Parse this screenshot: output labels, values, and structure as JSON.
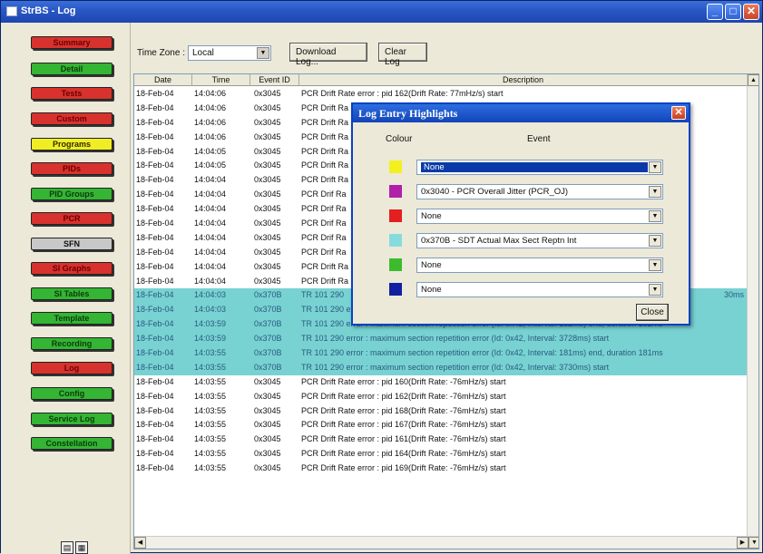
{
  "window": {
    "title": "StrBS - Log"
  },
  "sidebar": {
    "items": [
      {
        "label": "Summary",
        "color": "red"
      },
      {
        "label": "Detail",
        "color": "green"
      },
      {
        "label": "Tests",
        "color": "red"
      },
      {
        "label": "Custom",
        "color": "red"
      },
      {
        "label": "Programs",
        "color": "yellow"
      },
      {
        "label": "PIDs",
        "color": "red"
      },
      {
        "label": "PID Groups",
        "color": "green"
      },
      {
        "label": "PCR",
        "color": "red"
      },
      {
        "label": "SFN",
        "color": "gray"
      },
      {
        "label": "SI Graphs",
        "color": "red"
      },
      {
        "label": "SI Tables",
        "color": "green"
      },
      {
        "label": "Template",
        "color": "green"
      },
      {
        "label": "Recording",
        "color": "green"
      },
      {
        "label": "Log",
        "color": "red"
      },
      {
        "label": "Config",
        "color": "green"
      },
      {
        "label": "Service Log",
        "color": "green"
      },
      {
        "label": "Constellation",
        "color": "green"
      }
    ]
  },
  "toolbar": {
    "timezone_label": "Time Zone :",
    "timezone_value": "Local",
    "download_label": "Download Log...",
    "clear_label": "Clear Log"
  },
  "log": {
    "headers": [
      "Date",
      "Time",
      "Event ID",
      "Description"
    ],
    "rows": [
      {
        "date": "18-Feb-04",
        "time": "14:04:06",
        "id": "0x3045",
        "desc": "PCR Drift Rate error : pid 162(Drift Rate: 77mHz/s) start",
        "hl": false
      },
      {
        "date": "18-Feb-04",
        "time": "14:04:06",
        "id": "0x3045",
        "desc": "PCR Drift Ra",
        "hl": false
      },
      {
        "date": "18-Feb-04",
        "time": "14:04:06",
        "id": "0x3045",
        "desc": "PCR Drift Ra",
        "hl": false
      },
      {
        "date": "18-Feb-04",
        "time": "14:04:06",
        "id": "0x3045",
        "desc": "PCR Drift Ra",
        "hl": false
      },
      {
        "date": "18-Feb-04",
        "time": "14:04:05",
        "id": "0x3045",
        "desc": "PCR Drift Ra",
        "hl": false
      },
      {
        "date": "18-Feb-04",
        "time": "14:04:05",
        "id": "0x3045",
        "desc": "PCR Drift Ra",
        "hl": false
      },
      {
        "date": "18-Feb-04",
        "time": "14:04:04",
        "id": "0x3045",
        "desc": "PCR Drift Ra",
        "hl": false
      },
      {
        "date": "18-Feb-04",
        "time": "14:04:04",
        "id": "0x3045",
        "desc": "PCR Drif Ra",
        "hl": false
      },
      {
        "date": "18-Feb-04",
        "time": "14:04:04",
        "id": "0x3045",
        "desc": "PCR Drif Ra",
        "hl": false
      },
      {
        "date": "18-Feb-04",
        "time": "14:04:04",
        "id": "0x3045",
        "desc": "PCR Drif Ra",
        "hl": false
      },
      {
        "date": "18-Feb-04",
        "time": "14:04:04",
        "id": "0x3045",
        "desc": "PCR Drif Ra",
        "hl": false
      },
      {
        "date": "18-Feb-04",
        "time": "14:04:04",
        "id": "0x3045",
        "desc": "PCR Drif Ra",
        "hl": false
      },
      {
        "date": "18-Feb-04",
        "time": "14:04:04",
        "id": "0x3045",
        "desc": "PCR Drift Ra",
        "hl": false
      },
      {
        "date": "18-Feb-04",
        "time": "14:04:04",
        "id": "0x3045",
        "desc": "PCR Drift Ra",
        "hl": false
      },
      {
        "date": "18-Feb-04",
        "time": "14:04:03",
        "id": "0x370B",
        "desc": "TR 101 290",
        "hl": true
      },
      {
        "date": "18-Feb-04",
        "time": "14:04:03",
        "id": "0x370B",
        "desc": "TR 101 290 error : maximum section repetition error (Id: 0x42, Interval: 3730ms) start",
        "hl": true
      },
      {
        "date": "18-Feb-04",
        "time": "14:03:59",
        "id": "0x370B",
        "desc": "TR 101 290 error : maximum section repetition error (Id: 0x42, Interval: 182ms) end, duration 182ms",
        "hl": true
      },
      {
        "date": "18-Feb-04",
        "time": "14:03:59",
        "id": "0x370B",
        "desc": "TR 101 290 error : maximum section repetition error (Id: 0x42, Interval: 3728ms) start",
        "hl": true
      },
      {
        "date": "18-Feb-04",
        "time": "14:03:55",
        "id": "0x370B",
        "desc": "TR 101 290 error : maximum section repetition error (Id: 0x42, Interval: 181ms) end, duration 181ms",
        "hl": true
      },
      {
        "date": "18-Feb-04",
        "time": "14:03:55",
        "id": "0x370B",
        "desc": "TR 101 290 error : maximum section repetition error (Id: 0x42, Interval: 3730ms) start",
        "hl": true
      },
      {
        "date": "18-Feb-04",
        "time": "14:03:55",
        "id": "0x3045",
        "desc": "PCR Drift Rate error : pid 160(Drift Rate: -76mHz/s) start",
        "hl": false
      },
      {
        "date": "18-Feb-04",
        "time": "14:03:55",
        "id": "0x3045",
        "desc": "PCR Drift Rate error : pid 162(Drift Rate: -76mHz/s) start",
        "hl": false
      },
      {
        "date": "18-Feb-04",
        "time": "14:03:55",
        "id": "0x3045",
        "desc": "PCR Drift Rate error : pid 168(Drift Rate: -76mHz/s) start",
        "hl": false
      },
      {
        "date": "18-Feb-04",
        "time": "14:03:55",
        "id": "0x3045",
        "desc": "PCR Drift Rate error : pid 167(Drift Rate: -76mHz/s) start",
        "hl": false
      },
      {
        "date": "18-Feb-04",
        "time": "14:03:55",
        "id": "0x3045",
        "desc": "PCR Drift Rate error : pid 161(Drift Rate: -76mHz/s) start",
        "hl": false
      },
      {
        "date": "18-Feb-04",
        "time": "14:03:55",
        "id": "0x3045",
        "desc": "PCR Drift Rate error : pid 164(Drift Rate: -76mHz/s) start",
        "hl": false
      },
      {
        "date": "18-Feb-04",
        "time": "14:03:55",
        "id": "0x3045",
        "desc": "PCR Drift Rate error : pid 169(Drift Rate: -76mHz/s) start",
        "hl": false
      }
    ],
    "row_tail_text": "30ms"
  },
  "dialog": {
    "title": "Log Entry Highlights",
    "colour_header": "Colour",
    "event_header": "Event",
    "entries": [
      {
        "color": "#f4f020",
        "value": "None",
        "selected": true
      },
      {
        "color": "#b020a8",
        "value": "0x3040 - PCR Overall Jitter (PCR_OJ)",
        "selected": false
      },
      {
        "color": "#e22020",
        "value": "None",
        "selected": false
      },
      {
        "color": "#86dcdc",
        "value": "0x370B - SDT Actual Max Sect Reptn Int",
        "selected": false
      },
      {
        "color": "#3cbc2c",
        "value": "None",
        "selected": false
      },
      {
        "color": "#1020a0",
        "value": "None",
        "selected": false
      }
    ],
    "close_label": "Close"
  },
  "colors": {
    "highlight_row": "#78d2d2",
    "titlebar": "#2a58c6",
    "sidebar_red": "#d8322e",
    "sidebar_green": "#34b534",
    "sidebar_yellow": "#f0ee22",
    "sidebar_gray": "#c8c8c8"
  }
}
